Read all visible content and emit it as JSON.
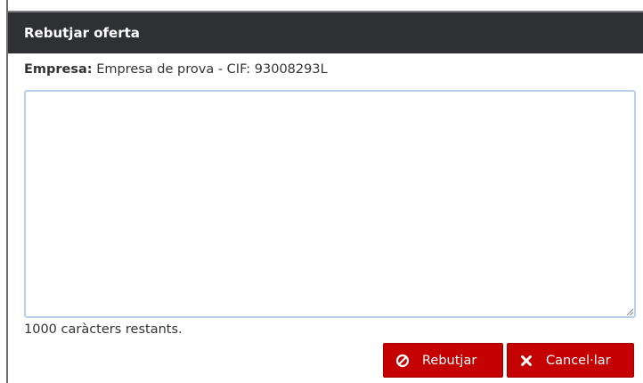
{
  "dialog": {
    "title": "Rebutjar oferta",
    "company_label": "Empresa:",
    "company_value": "Empresa de prova - CIF: 93008293L",
    "textarea_value": "",
    "chars_remaining": "1000 caràcters restants.",
    "buttons": {
      "reject_label": "Rebutjar",
      "cancel_label": "Cancel·lar"
    }
  },
  "colors": {
    "header_bg": "#2f3033",
    "button_bg": "#c40000",
    "textarea_border": "#b9d0ea"
  },
  "icons": {
    "reject": "ban-icon",
    "cancel": "close-icon"
  }
}
